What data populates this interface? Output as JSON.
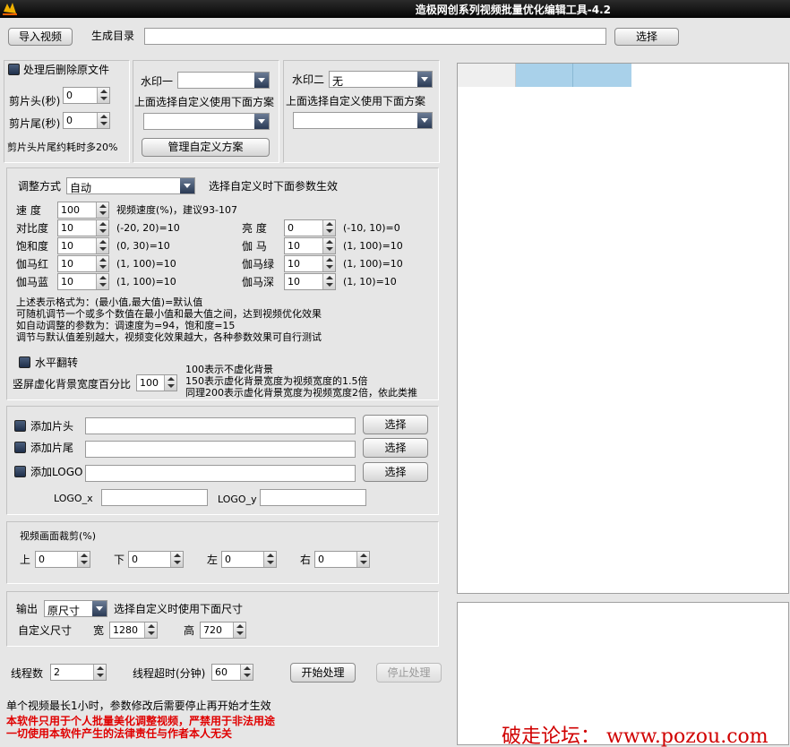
{
  "window": {
    "title": "造极网创系列视频批量优化编辑工具-4.2"
  },
  "top": {
    "import_label": "导入视频",
    "outdir_label": "生成目录",
    "outdir_value": "",
    "choose_label": "选择"
  },
  "trim": {
    "delete_original_label": "处理后删除原文件",
    "head_label": "剪片头(秒)",
    "head_value": "0",
    "tail_label": "剪片尾(秒)",
    "tail_value": "0",
    "note": "剪片头片尾约耗时多20%"
  },
  "watermark1": {
    "label": "水印一",
    "value": "",
    "hint": "上面选择自定义使用下面方案",
    "scheme_value": "",
    "manage_label": "管理自定义方案"
  },
  "watermark2": {
    "label": "水印二",
    "value": "无",
    "hint": "上面选择自定义使用下面方案",
    "scheme_value": ""
  },
  "adjust": {
    "mode_label": "调整方式",
    "mode_value": "自动",
    "mode_hint": "选择自定义时下面参数生效",
    "left_params": [
      {
        "label": "速  度",
        "value": "100",
        "range": "视频速度(%)，建议93-107"
      },
      {
        "label": "对比度",
        "value": "10",
        "range": "(-20, 20)=10"
      },
      {
        "label": "饱和度",
        "value": "10",
        "range": "(0, 30)=10"
      },
      {
        "label": "伽马红",
        "value": "10",
        "range": "(1, 100)=10"
      },
      {
        "label": "伽马蓝",
        "value": "10",
        "range": "(1, 100)=10"
      }
    ],
    "right_params": [
      {
        "label": "亮  度",
        "value": "0",
        "range": "(-10, 10)=0"
      },
      {
        "label": "伽  马",
        "value": "10",
        "range": "(1, 100)=10"
      },
      {
        "label": "伽马绿",
        "value": "10",
        "range": "(1, 100)=10"
      },
      {
        "label": "伽马深",
        "value": "10",
        "range": "(1, 10)=10"
      }
    ],
    "notes": [
      "上述表示格式为：(最小值,最大值)=默认值",
      "可随机调节一个或多个数值在最小值和最大值之间，达到视频优化效果",
      "如自动调整的参数为：调速度为=94，饱和度=15",
      "调节与默认值差别越大，视频变化效果越大，各种参数效果可自行测试"
    ],
    "hflip_label": "水平翻转",
    "blur_label": "竖屏虚化背景宽度百分比",
    "blur_value": "100",
    "blur_notes": [
      "100表示不虚化背景",
      "150表示虚化背景宽度为视频宽度的1.5倍",
      "同理200表示虚化背景宽度为视频宽度2倍，依此类推"
    ]
  },
  "add": {
    "head_label": "添加片头",
    "tail_label": "添加片尾",
    "logo_label": "添加LOGO",
    "choose_label": "选择",
    "logo_x_label": "LOGO_x",
    "logo_y_label": "LOGO_y"
  },
  "crop": {
    "title": "视频画面裁剪(%)",
    "top_label": "上",
    "top_value": "0",
    "bottom_label": "下",
    "bottom_value": "0",
    "left_label": "左",
    "left_value": "0",
    "right_label": "右",
    "right_value": "0"
  },
  "output": {
    "label": "输出",
    "value": "原尺寸",
    "hint": "选择自定义时使用下面尺寸",
    "custom_label": "自定义尺寸",
    "width_label": "宽",
    "width_value": "1280",
    "height_label": "高",
    "height_value": "720"
  },
  "run": {
    "threads_label": "线程数",
    "threads_value": "2",
    "timeout_label": "线程超时(分钟)",
    "timeout_value": "60",
    "start_label": "开始处理",
    "stop_label": "停止处理"
  },
  "footer": {
    "note": "单个视频最长1小时，参数修改后需要停止再开始才生效",
    "warning1": "本软件只用于个人批量美化调整视频，严禁用于非法用途",
    "warning2": "一切使用本软件产生的法律责任与作者本人无关",
    "watermark": "破走论坛： www.pozou.com"
  },
  "colors": {
    "accent": "#a9d1ea",
    "warning": "#e00000"
  }
}
